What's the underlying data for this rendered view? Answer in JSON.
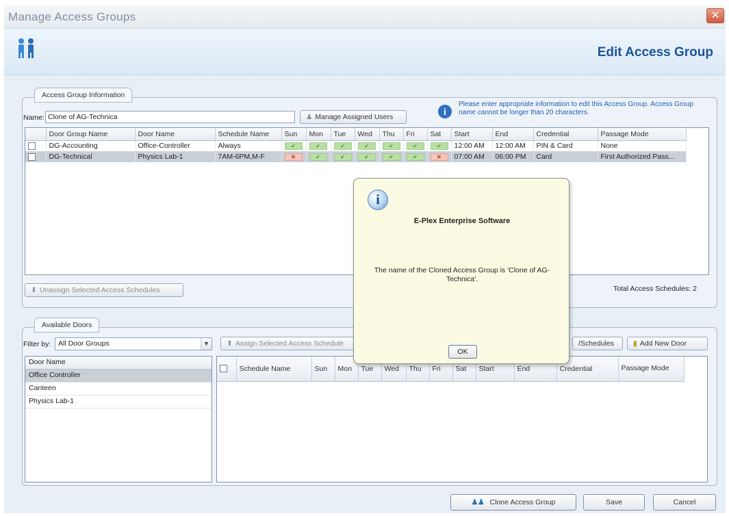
{
  "window": {
    "title": "Manage Access Groups",
    "close_glyph": "✕",
    "header_title": "Edit Access Group",
    "header_icon": "users-icon"
  },
  "access_group_info": {
    "legend": "Access Group Information",
    "name_label": "Name:",
    "name_value": "Clone of AG-Technica",
    "manage_users_button": "Manage Assigned Users",
    "info_text": "Please enter appropriate information to edit this Access Group. Access Group name cannot be longer than 20 characters.",
    "unassign_button": "Unassign Selected Access Schedules",
    "total_schedules": "Total Access Schedules: 2"
  },
  "schedule_table": {
    "columns": [
      "",
      "Door Group Name",
      "Door Name",
      "Schedule Name",
      "Sun",
      "Mon",
      "Tue",
      "Wed",
      "Thu",
      "Fri",
      "Sat",
      "Start",
      "End",
      "Credential",
      "Passage Mode"
    ],
    "rows": [
      {
        "door_group": "DG-Accounting",
        "door": "Office-Controller",
        "schedule": "Always",
        "days": [
          true,
          true,
          true,
          true,
          true,
          true,
          true
        ],
        "start": "12:00 AM",
        "end": "12:00 AM",
        "credential": "PIN & Card",
        "passage": "None"
      },
      {
        "door_group": "DG-Technical",
        "door": "Physics Lab-1",
        "schedule": "7AM-6PM,M-F",
        "days": [
          false,
          true,
          true,
          true,
          true,
          true,
          false
        ],
        "start": "07:00 AM",
        "end": "06:00 PM",
        "credential": "Card",
        "passage": "First Authorized Pass..."
      }
    ]
  },
  "available_doors": {
    "legend": "Available Doors",
    "filter_label": "Filter by:",
    "filter_value": "All Door Groups",
    "assign_button": "Assign Selected Access Schedule",
    "schedules_button": "/Schedules",
    "add_new_door_button": "Add New Door",
    "door_list_header": "Door Name",
    "doors": [
      "Office Controller",
      "Canteen",
      "Physics Lab-1"
    ],
    "schedule_columns": [
      "Schedule Name",
      "Sun",
      "Mon",
      "Tue",
      "Wed",
      "Thu",
      "Fri",
      "Sat",
      "Start",
      "End",
      "Credential",
      "Passage Mode"
    ]
  },
  "dialog": {
    "title": "E-Plex Enterprise Software",
    "message": "The name of the Cloned Access Group is 'Clone of AG-Technica'.",
    "ok": "OK",
    "icon": "info-icon"
  },
  "footer": {
    "clone_button": "Clone Access Group",
    "save_button": "Save",
    "cancel_button": "Cancel"
  },
  "colors": {
    "header_title": "#1a5499",
    "day_enabled": "#b9dfa5",
    "day_disabled": "#f3c6b8",
    "dialog_bg": "#fbfbe4"
  }
}
